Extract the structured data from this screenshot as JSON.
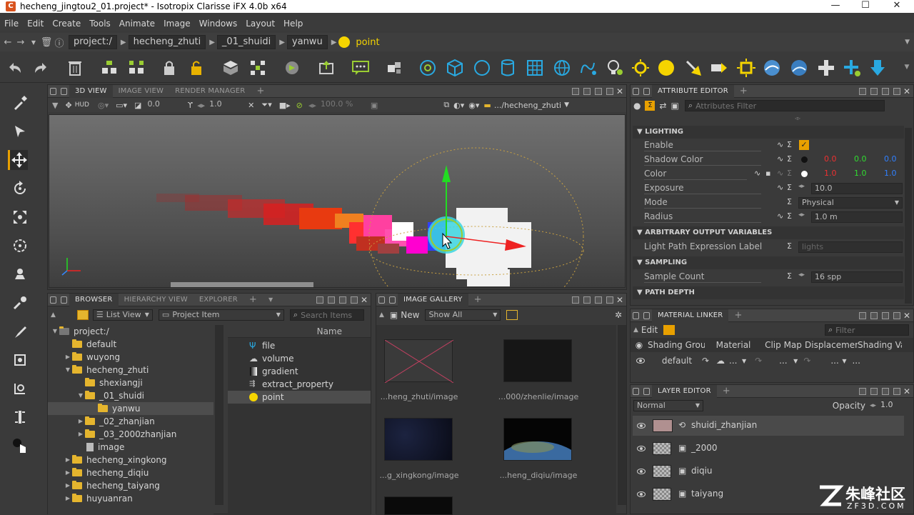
{
  "window": {
    "title": "hecheng_jingtou2_01.project* - Isotropix Clarisse iFX 4.0b x64"
  },
  "menu": [
    "File",
    "Edit",
    "Create",
    "Tools",
    "Animate",
    "Image",
    "Windows",
    "Layout",
    "Help"
  ],
  "breadcrumb": [
    "project:/",
    "hecheng_zhuti",
    "_01_shuidi",
    "yanwu"
  ],
  "current_item": "point",
  "viewport": {
    "tabs": [
      "3D VIEW",
      "IMAGE VIEW",
      "RENDER MANAGER"
    ],
    "active_tab": "3D VIEW",
    "hud_label": "HUD",
    "field1": "0.0",
    "field2": "1.0",
    "field3": "100.0 %",
    "path": ".../hecheng_zhuti"
  },
  "browser": {
    "tabs": [
      "BROWSER",
      "HIERARCHY VIEW",
      "EXPLORER"
    ],
    "active_tab": "BROWSER",
    "view_mode": "List View",
    "item_type": "Project Item",
    "search_placeholder": "Search Items",
    "tree": [
      {
        "label": "project:/",
        "depth": 0,
        "expanded": true
      },
      {
        "label": "default",
        "depth": 1,
        "expanded": null
      },
      {
        "label": "wuyong",
        "depth": 1,
        "expanded": false
      },
      {
        "label": "hecheng_zhuti",
        "depth": 1,
        "expanded": true
      },
      {
        "label": "shexiangji",
        "depth": 2,
        "expanded": null
      },
      {
        "label": "_01_shuidi",
        "depth": 2,
        "expanded": true
      },
      {
        "label": "yanwu",
        "depth": 3,
        "expanded": null,
        "selected": true
      },
      {
        "label": "_02_zhanjian",
        "depth": 2,
        "expanded": false
      },
      {
        "label": "_03_2000zhanjian",
        "depth": 2,
        "expanded": false
      },
      {
        "label": "image",
        "depth": 2,
        "expanded": null
      },
      {
        "label": "hecheng_xingkong",
        "depth": 1,
        "expanded": false
      },
      {
        "label": "hecheng_diqiu",
        "depth": 1,
        "expanded": false
      },
      {
        "label": "hecheng_taiyang",
        "depth": 1,
        "expanded": false
      },
      {
        "label": "huyuanran",
        "depth": 1,
        "expanded": false
      }
    ],
    "list_header": "Name",
    "list_items": [
      "file",
      "volume",
      "gradient",
      "extract_property",
      "point"
    ]
  },
  "gallery": {
    "tab": "IMAGE GALLERY",
    "new_label": "New",
    "filter": "Show All",
    "images": [
      {
        "label": "...heng_zhuti/image",
        "bg": "#3a3a3a",
        "empty": true
      },
      {
        "label": "...000/zhenlie/image",
        "bg": "#161616",
        "empty": false
      },
      {
        "label": "...g_xingkong/image",
        "bg": "#0d1020",
        "empty": false
      },
      {
        "label": "...heng_diqiu/image",
        "bg": "#0a0a0a",
        "empty": false
      }
    ]
  },
  "attribute_editor": {
    "tab": "ATTRIBUTE EDITOR",
    "filter_placeholder": "Attributes Filter",
    "sections": {
      "lighting": "LIGHTING",
      "aov": "ARBITRARY OUTPUT VARIABLES",
      "sampling": "SAMPLING",
      "path_depth": "PATH DEPTH"
    },
    "attrs": {
      "enable": "Enable",
      "shadow_color": {
        "label": "Shadow Color",
        "r": "0.0",
        "g": "0.0",
        "b": "0.0"
      },
      "color": {
        "label": "Color",
        "r": "1.0",
        "g": "1.0",
        "b": "1.0"
      },
      "exposure": {
        "label": "Exposure",
        "value": "10.0"
      },
      "mode": {
        "label": "Mode",
        "value": "Physical"
      },
      "radius": {
        "label": "Radius",
        "value": "1.0 m"
      },
      "lpe": {
        "label": "Light Path Expression Label",
        "value": "lights"
      },
      "sample_count": {
        "label": "Sample Count",
        "value": "16 spp"
      }
    }
  },
  "material_linker": {
    "tab": "MATERIAL LINKER",
    "edit_label": "Edit",
    "filter_placeholder": "Filter",
    "columns": [
      "Shading Group",
      "Material",
      "Clip Map",
      "Displacement",
      "Shading Variab"
    ],
    "row": "default",
    "row_dots": "..."
  },
  "layer_editor": {
    "tab": "LAYER EDITOR",
    "blend_mode": "Normal",
    "opacity_label": "Opacity",
    "opacity": "1.0",
    "layers": [
      "shuidi_zhanjian",
      "_2000",
      "diqiu",
      "taiyang"
    ]
  },
  "watermark": {
    "cn": "朱峰社区",
    "en": "ZF3D.COM"
  }
}
